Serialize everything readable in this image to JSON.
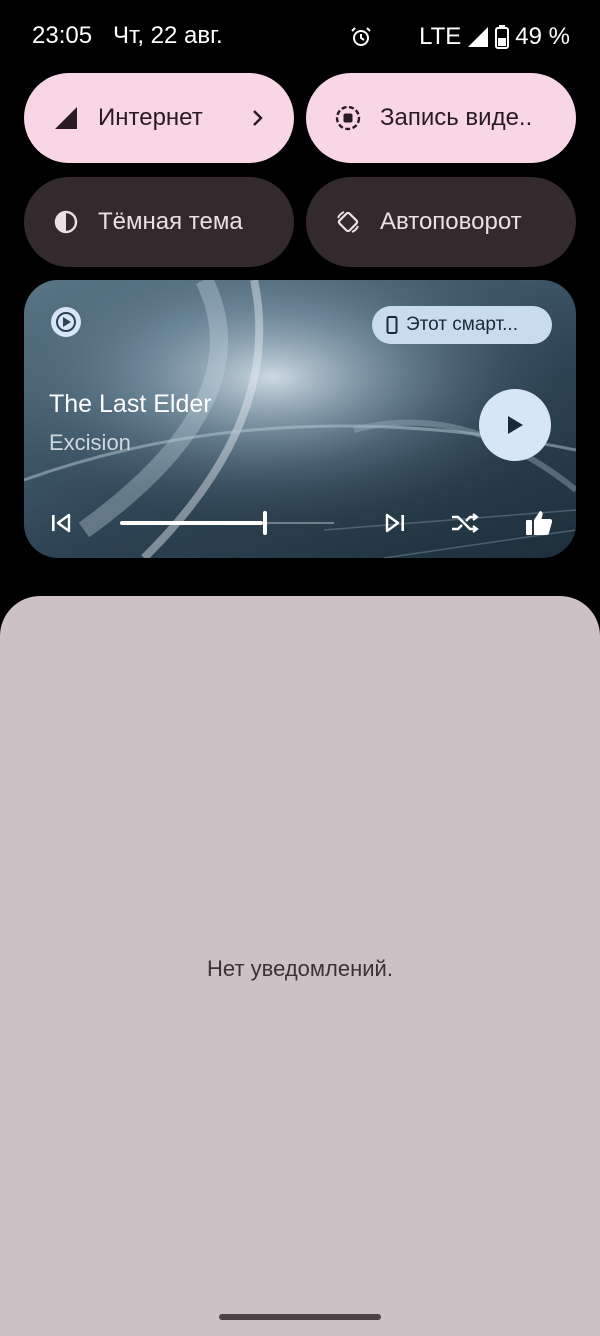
{
  "status_bar": {
    "time": "23:05",
    "date": "Чт, 22 авг.",
    "network": "LTE",
    "battery": "49 %",
    "icons": [
      "alarm-icon",
      "signal-icon",
      "battery-icon"
    ]
  },
  "quick_settings": {
    "tiles": [
      {
        "label": "Интернет",
        "icon": "signal-icon",
        "state": "active",
        "has_chevron": true
      },
      {
        "label": "Запись виде..",
        "icon": "screen-record-icon",
        "state": "active"
      },
      {
        "label": "Тёмная тема",
        "icon": "dark-theme-icon",
        "state": "inactive"
      },
      {
        "label": "Автоповорот",
        "icon": "auto-rotate-icon",
        "state": "inactive"
      }
    ]
  },
  "media_player": {
    "app_icon": "youtube-music-icon",
    "output_device": "Этот смарт...",
    "track_title": "The Last Elder",
    "artist": "Excision",
    "progress": 0.67,
    "controls": [
      "previous-icon",
      "play-icon",
      "next-icon",
      "shuffle-icon",
      "thumbs-up-icon"
    ]
  },
  "notifications": {
    "empty_text": "Нет уведомлений."
  },
  "colors": {
    "tile_active": "#f8d6e5",
    "tile_inactive": "#332a2e",
    "shade_bg": "#cec1c6",
    "play_button": "#d6e6f6"
  }
}
